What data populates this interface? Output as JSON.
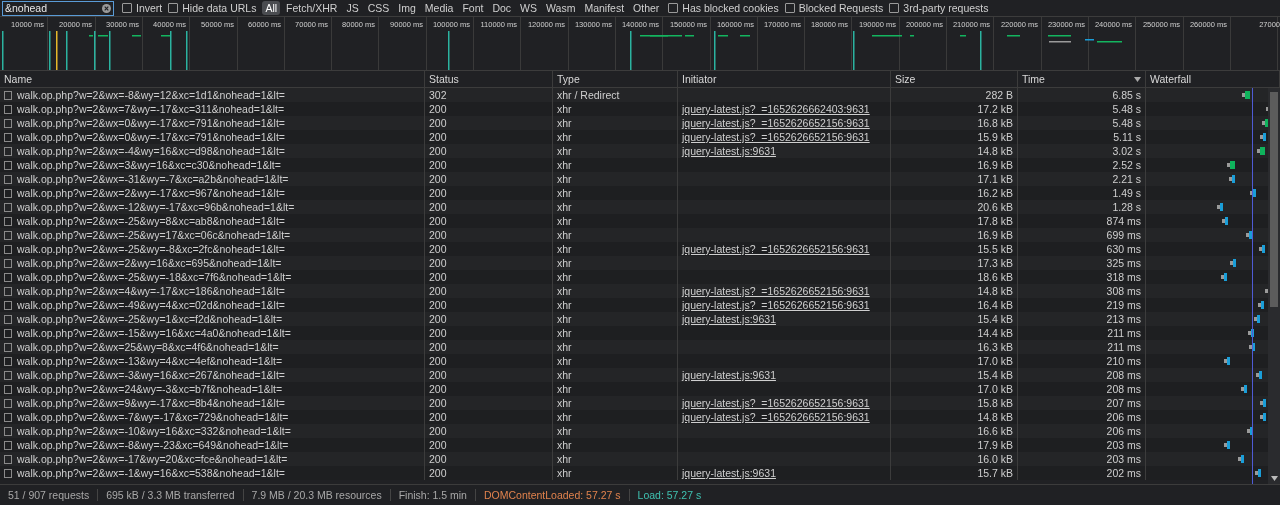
{
  "filter_bar": {
    "search": {
      "value": "&nohead"
    },
    "left_checkboxes": [
      {
        "label": "Invert",
        "checked": false
      },
      {
        "label": "Hide data URLs",
        "checked": false
      }
    ],
    "type_filters": [
      {
        "label": "All",
        "selected": true
      },
      {
        "label": "Fetch/XHR",
        "selected": false
      },
      {
        "label": "JS",
        "selected": false
      },
      {
        "label": "CSS",
        "selected": false
      },
      {
        "label": "Img",
        "selected": false
      },
      {
        "label": "Media",
        "selected": false
      },
      {
        "label": "Font",
        "selected": false
      },
      {
        "label": "Doc",
        "selected": false
      },
      {
        "label": "WS",
        "selected": false
      },
      {
        "label": "Wasm",
        "selected": false
      },
      {
        "label": "Manifest",
        "selected": false
      },
      {
        "label": "Other",
        "selected": false
      }
    ],
    "right_checkboxes": [
      {
        "label": "Has blocked cookies",
        "checked": false
      },
      {
        "label": "Blocked Requests",
        "checked": false
      },
      {
        "label": "3rd-party requests",
        "checked": false
      }
    ]
  },
  "overview": {
    "ticks": [
      "10000 ms",
      "20000 ms",
      "30000 ms",
      "40000 ms",
      "50000 ms",
      "60000 ms",
      "70000 ms",
      "80000 ms",
      "90000 ms",
      "100000 ms",
      "110000 ms",
      "120000 ms",
      "130000 ms",
      "140000 ms",
      "150000 ms",
      "160000 ms",
      "170000 ms",
      "180000 ms",
      "190000 ms",
      "200000 ms",
      "210000 ms",
      "220000 ms",
      "230000 ms",
      "240000 ms",
      "250000 ms",
      "260000 ms",
      "27000"
    ]
  },
  "table": {
    "columns": [
      {
        "label": "Name",
        "sorted": false
      },
      {
        "label": "Status",
        "sorted": false
      },
      {
        "label": "Type",
        "sorted": false
      },
      {
        "label": "Initiator",
        "sorted": false
      },
      {
        "label": "Size",
        "sorted": false
      },
      {
        "label": "Time",
        "sorted": true
      },
      {
        "label": "Waterfall",
        "sorted": false
      }
    ],
    "rows": [
      {
        "name": "walk.op.php?w=2&wx=-8&wy=12&xc=1d1&nohead=1&lt=",
        "status": "302",
        "type": "xhr / Redirect",
        "size": "282 B",
        "time": "6.85 s"
      },
      {
        "name": "walk.op.php?w=2&wx=7&wy=-17&xc=311&nohead=1&lt=",
        "status": "200",
        "type": "xhr",
        "initiator": "jquery-latest.js?_=1652626662403:9631",
        "size": "17.2 kB",
        "time": "5.48 s"
      },
      {
        "name": "walk.op.php?w=2&wx=0&wy=-17&xc=791&nohead=1&lt=",
        "status": "200",
        "type": "xhr",
        "initiator": "jquery-latest.js?_=1652626652156:9631",
        "size": "16.8 kB",
        "time": "5.48 s"
      },
      {
        "name": "walk.op.php?w=2&wx=0&wy=-17&xc=791&nohead=1&lt=",
        "status": "200",
        "type": "xhr",
        "initiator": "jquery-latest.js?_=1652626652156:9631",
        "size": "15.9 kB",
        "time": "5.11 s"
      },
      {
        "name": "walk.op.php?w=2&wx=-4&wy=16&xc=d98&nohead=1&lt=",
        "status": "200",
        "type": "xhr",
        "initiator": "jquery-latest.js:9631",
        "size": "14.8 kB",
        "time": "3.02 s"
      },
      {
        "name": "walk.op.php?w=2&wx=3&wy=16&xc=c30&nohead=1&lt=",
        "status": "200",
        "type": "xhr",
        "size": "16.9 kB",
        "time": "2.52 s"
      },
      {
        "name": "walk.op.php?w=2&wx=-31&wy=-7&xc=a2b&nohead=1&lt=",
        "status": "200",
        "type": "xhr",
        "size": "17.1 kB",
        "time": "2.21 s"
      },
      {
        "name": "walk.op.php?w=2&wx=2&wy=-17&xc=967&nohead=1&lt=",
        "status": "200",
        "type": "xhr",
        "size": "16.2 kB",
        "time": "1.49 s"
      },
      {
        "name": "walk.op.php?w=2&wx=-12&wy=-17&xc=96b&nohead=1&lt=",
        "status": "200",
        "type": "xhr",
        "size": "20.6 kB",
        "time": "1.28 s"
      },
      {
        "name": "walk.op.php?w=2&wx=-25&wy=8&xc=ab8&nohead=1&lt=",
        "status": "200",
        "type": "xhr",
        "size": "17.8 kB",
        "time": "874 ms"
      },
      {
        "name": "walk.op.php?w=2&wx=-25&wy=17&xc=06c&nohead=1&lt=",
        "status": "200",
        "type": "xhr",
        "size": "16.9 kB",
        "time": "699 ms"
      },
      {
        "name": "walk.op.php?w=2&wx=-25&wy=-8&xc=2fc&nohead=1&lt=",
        "status": "200",
        "type": "xhr",
        "initiator": "jquery-latest.js?_=1652626652156:9631",
        "size": "15.5 kB",
        "time": "630 ms"
      },
      {
        "name": "walk.op.php?w=2&wx=2&wy=16&xc=695&nohead=1&lt=",
        "status": "200",
        "type": "xhr",
        "size": "17.3 kB",
        "time": "325 ms"
      },
      {
        "name": "walk.op.php?w=2&wx=-25&wy=-18&xc=7f6&nohead=1&lt=",
        "status": "200",
        "type": "xhr",
        "size": "18.6 kB",
        "time": "318 ms"
      },
      {
        "name": "walk.op.php?w=2&wx=4&wy=-17&xc=186&nohead=1&lt=",
        "status": "200",
        "type": "xhr",
        "initiator": "jquery-latest.js?_=1652626652156:9631",
        "size": "14.8 kB",
        "time": "308 ms"
      },
      {
        "name": "walk.op.php?w=2&wx=-49&wy=4&xc=02d&nohead=1&lt=",
        "status": "200",
        "type": "xhr",
        "initiator": "jquery-latest.js?_=1652626652156:9631",
        "size": "16.4 kB",
        "time": "219 ms"
      },
      {
        "name": "walk.op.php?w=2&wx=-25&wy=1&xc=f2d&nohead=1&lt=",
        "status": "200",
        "type": "xhr",
        "initiator": "jquery-latest.js:9631",
        "size": "15.4 kB",
        "time": "213 ms"
      },
      {
        "name": "walk.op.php?w=2&wx=-15&wy=16&xc=4a0&nohead=1&lt=",
        "status": "200",
        "type": "xhr",
        "size": "14.4 kB",
        "time": "211 ms"
      },
      {
        "name": "walk.op.php?w=2&wx=25&wy=8&xc=4f6&nohead=1&lt=",
        "status": "200",
        "type": "xhr",
        "size": "16.3 kB",
        "time": "211 ms"
      },
      {
        "name": "walk.op.php?w=2&wx=-13&wy=4&xc=4ef&nohead=1&lt=",
        "status": "200",
        "type": "xhr",
        "size": "17.0 kB",
        "time": "210 ms"
      },
      {
        "name": "walk.op.php?w=2&wx=-3&wy=16&xc=267&nohead=1&lt=",
        "status": "200",
        "type": "xhr",
        "initiator": "jquery-latest.js:9631",
        "size": "15.4 kB",
        "time": "208 ms"
      },
      {
        "name": "walk.op.php?w=2&wx=24&wy=-3&xc=b7f&nohead=1&lt=",
        "status": "200",
        "type": "xhr",
        "size": "17.0 kB",
        "time": "208 ms"
      },
      {
        "name": "walk.op.php?w=2&wx=9&wy=-17&xc=8b4&nohead=1&lt=",
        "status": "200",
        "type": "xhr",
        "initiator": "jquery-latest.js?_=1652626652156:9631",
        "size": "15.8 kB",
        "time": "207 ms"
      },
      {
        "name": "walk.op.php?w=2&wx=-7&wy=-17&xc=729&nohead=1&lt=",
        "status": "200",
        "type": "xhr",
        "initiator": "jquery-latest.js?_=1652626652156:9631",
        "size": "14.8 kB",
        "time": "206 ms"
      },
      {
        "name": "walk.op.php?w=2&wx=-10&wy=16&xc=332&nohead=1&lt=",
        "status": "200",
        "type": "xhr",
        "size": "16.6 kB",
        "time": "206 ms"
      },
      {
        "name": "walk.op.php?w=2&wx=-8&wy=-23&xc=649&nohead=1&lt=",
        "status": "200",
        "type": "xhr",
        "size": "17.9 kB",
        "time": "203 ms"
      },
      {
        "name": "walk.op.php?w=2&wx=-17&wy=20&xc=fce&nohead=1&lt=",
        "status": "200",
        "type": "xhr",
        "size": "16.0 kB",
        "time": "203 ms"
      },
      {
        "name": "walk.op.php?w=2&wx=-1&wy=16&xc=538&nohead=1&lt=",
        "status": "200",
        "type": "xhr",
        "initiator": "jquery-latest.js:9631",
        "size": "15.7 kB",
        "time": "202 ms"
      }
    ]
  },
  "status_bar": [
    {
      "text": "51 / 907 requests",
      "kind": "plain"
    },
    {
      "text": "695 kB / 3.3 MB transferred",
      "kind": "plain"
    },
    {
      "text": "7.9 MB / 20.3 MB resources",
      "kind": "plain"
    },
    {
      "text": "Finish: 1.5 min",
      "kind": "plain"
    },
    {
      "text": "DOMContentLoaded: 57.27 s",
      "kind": "dom"
    },
    {
      "text": "Load: 57.27 s",
      "kind": "load"
    }
  ]
}
